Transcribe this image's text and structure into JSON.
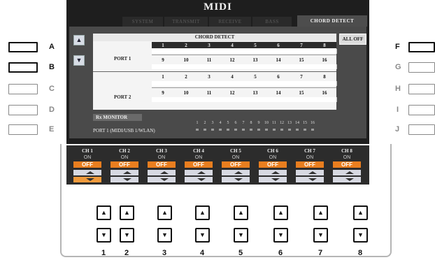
{
  "screen": {
    "title": "MIDI",
    "tabs": [
      {
        "label": "SYSTEM",
        "active": false
      },
      {
        "label": "TRANSMIT",
        "active": false
      },
      {
        "label": "RECEIVE",
        "active": false
      },
      {
        "label": "BASS",
        "active": false
      },
      {
        "label": "CHORD DETECT",
        "active": true
      }
    ],
    "up_arrow": "▲",
    "down_arrow": "▼",
    "table_title": "CHORD DETECT",
    "port1_label": "PORT 1",
    "port2_label": "PORT 2",
    "row_top_numbers": [
      "1",
      "2",
      "3",
      "4",
      "5",
      "6",
      "7",
      "8"
    ],
    "row_bottom_numbers": [
      "9",
      "10",
      "11",
      "12",
      "13",
      "14",
      "15",
      "16"
    ],
    "all_off_label": "ALL OFF",
    "rx_monitor_label": "Rx MONITOR",
    "rx_port1_label": "PORT 1 (MIDI/USB 1/WLAN)",
    "rx_channels": [
      "1",
      "2",
      "3",
      "4",
      "5",
      "6",
      "7",
      "8",
      "9",
      "10",
      "11",
      "12",
      "13",
      "14",
      "15",
      "16"
    ]
  },
  "channels": [
    {
      "name": "CH 1",
      "on": "ON",
      "off": "OFF"
    },
    {
      "name": "CH 2",
      "on": "ON",
      "off": "OFF"
    },
    {
      "name": "CH 3",
      "on": "ON",
      "off": "OFF"
    },
    {
      "name": "CH 4",
      "on": "ON",
      "off": "OFF"
    },
    {
      "name": "CH 5",
      "on": "ON",
      "off": "OFF"
    },
    {
      "name": "CH 6",
      "on": "ON",
      "off": "OFF"
    },
    {
      "name": "CH 7",
      "on": "ON",
      "off": "OFF"
    },
    {
      "name": "CH 8",
      "on": "ON",
      "off": "OFF"
    }
  ],
  "side_buttons_left": [
    "A",
    "B",
    "C",
    "D",
    "E"
  ],
  "side_buttons_right": [
    "F",
    "G",
    "H",
    "I",
    "J"
  ],
  "bottom_button_numbers": [
    "1",
    "2",
    "3",
    "4",
    "5",
    "6",
    "7",
    "8"
  ],
  "button_up_symbol": "▲",
  "button_down_symbol": "▼",
  "colors": {
    "accent_orange": "#e97e1f",
    "screen_bg": "#1e1e1e"
  }
}
